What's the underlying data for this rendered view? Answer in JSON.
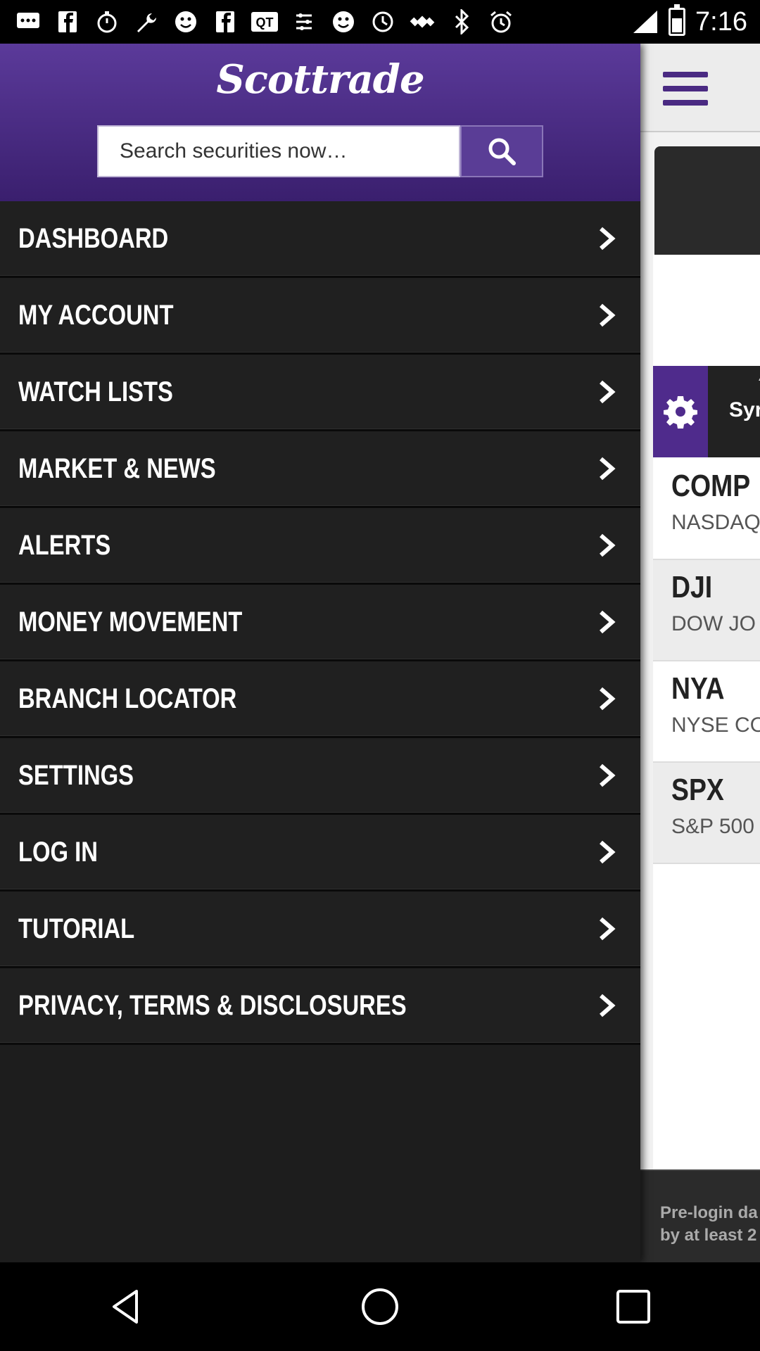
{
  "status_bar": {
    "time": "7:16",
    "icons": [
      "chat-icon",
      "facebook-icon",
      "stopwatch-icon",
      "wrench-icon",
      "smiley-icon",
      "facebook-icon",
      "qt-icon",
      "settings-icon",
      "smiley-icon",
      "timer-icon",
      "gps-icon",
      "bluetooth-icon",
      "alarm-icon",
      "signal-icon",
      "battery-icon"
    ]
  },
  "drawer": {
    "logo": "Scottrade",
    "search": {
      "placeholder": "Search securities now…"
    },
    "menu": [
      {
        "label": "DASHBOARD"
      },
      {
        "label": "MY ACCOUNT"
      },
      {
        "label": "WATCH LISTS"
      },
      {
        "label": "MARKET & NEWS"
      },
      {
        "label": "ALERTS"
      },
      {
        "label": "MONEY MOVEMENT"
      },
      {
        "label": "BRANCH LOCATOR"
      },
      {
        "label": "SETTINGS"
      },
      {
        "label": "LOG IN"
      },
      {
        "label": "TUTORIAL"
      },
      {
        "label": "PRIVACY, TERMS & DISCLOSURES"
      }
    ]
  },
  "background": {
    "symbol_bar_text": "Syr",
    "quotes": [
      {
        "symbol": "COMP",
        "name": "NASDAQ"
      },
      {
        "symbol": "DJI",
        "name": "DOW JO"
      },
      {
        "symbol": "NYA",
        "name": "NYSE CO"
      },
      {
        "symbol": "SPX",
        "name": "S&P 500"
      }
    ],
    "footer_line1": "Pre-login da",
    "footer_line2": "by at least 2"
  },
  "colors": {
    "brand_purple": "#4f2b8c",
    "drawer_bg": "#1d1d1d"
  }
}
